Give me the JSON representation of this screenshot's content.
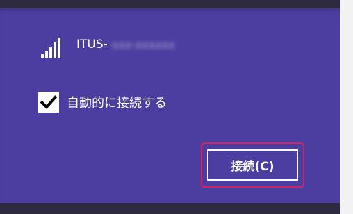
{
  "network": {
    "icon": "wifi-signal-icon",
    "name_prefix": "ITUS-",
    "name_obscured": "xxx-xxxxxx"
  },
  "auto_connect": {
    "checked": true,
    "label": "自動的に接続する"
  },
  "connect_button": {
    "label": "接続(C)"
  },
  "colors": {
    "panel": "#4b3ea0",
    "band": "#2e2a40",
    "highlight": "#d6245a"
  }
}
